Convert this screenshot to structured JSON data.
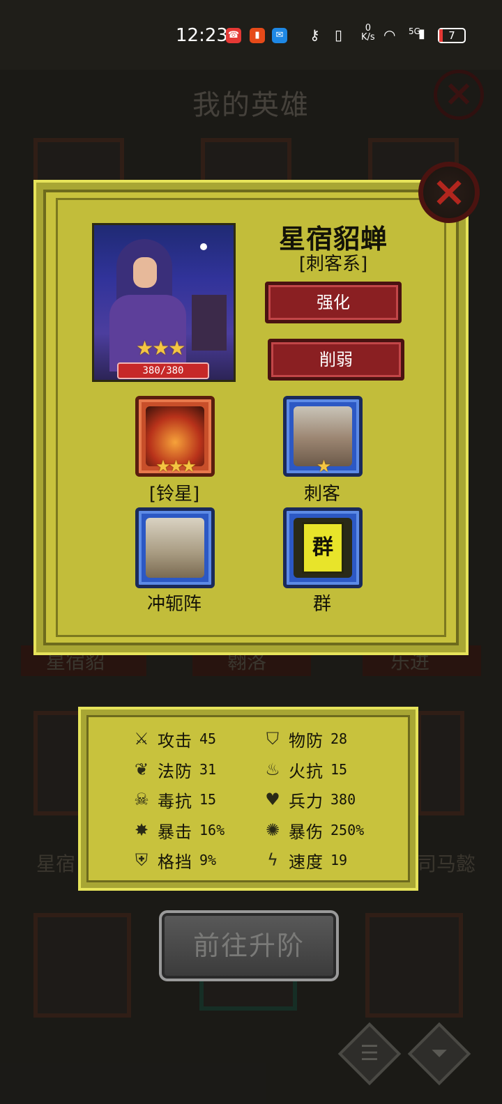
{
  "status_bar": {
    "time": "12:23",
    "net_speed_value": "0",
    "net_speed_unit": "K/s",
    "network": "5G",
    "battery": "7"
  },
  "background": {
    "title": "我的英雄",
    "hero_names_row1": [
      "星宿貂",
      "翱洛",
      "乐进"
    ],
    "hero_names_row2": [
      "星宿",
      "司马懿"
    ]
  },
  "hero": {
    "name": "星宿貂蝉",
    "class": "[刺客系]",
    "hp": "380/380",
    "stars": "★★★"
  },
  "buttons": {
    "strengthen": "强化",
    "weaken": "削弱",
    "upgrade": "前往升阶"
  },
  "skills": [
    {
      "label": "[铃星]",
      "stars": "★★★"
    },
    {
      "label": "刺客",
      "stars": "★"
    },
    {
      "label": "冲轭阵",
      "stars": ""
    },
    {
      "label": "群",
      "stars": "",
      "banner_text": "群"
    }
  ],
  "stats": [
    {
      "icon": "attack-icon",
      "name": "攻击",
      "value": "45"
    },
    {
      "icon": "physical-defense-icon",
      "name": "物防",
      "value": "28"
    },
    {
      "icon": "magic-defense-icon",
      "name": "法防",
      "value": "31"
    },
    {
      "icon": "fire-resist-icon",
      "name": "火抗",
      "value": "15"
    },
    {
      "icon": "poison-resist-icon",
      "name": "毒抗",
      "value": "15"
    },
    {
      "icon": "troops-icon",
      "name": "兵力",
      "value": "380"
    },
    {
      "icon": "crit-icon",
      "name": "暴击",
      "value": "16%"
    },
    {
      "icon": "crit-damage-icon",
      "name": "暴伤",
      "value": "250%"
    },
    {
      "icon": "block-icon",
      "name": "格挡",
      "value": "9%"
    },
    {
      "icon": "speed-icon",
      "name": "速度",
      "value": "19"
    }
  ],
  "colors": {
    "panel": "#c8c23d",
    "button_red": "#8a1f22",
    "tile_orange": "#c84f2a",
    "tile_blue": "#2c58c4"
  }
}
